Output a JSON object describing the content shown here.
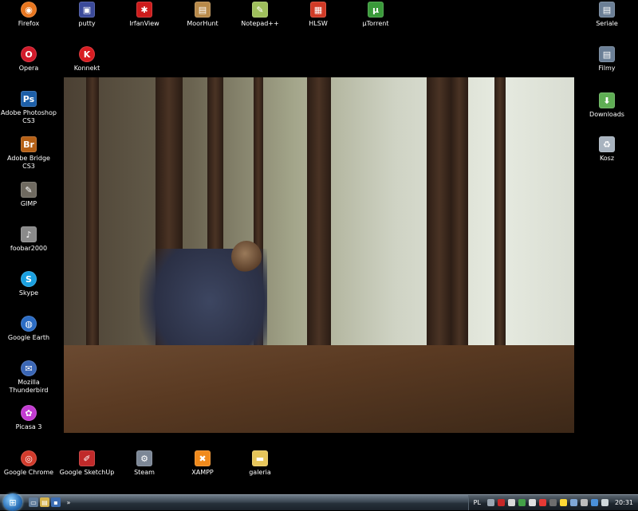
{
  "desktop": {
    "left_icons": [
      {
        "label": "Firefox",
        "name": "firefox",
        "glyph": "◉",
        "color": "#e8761f",
        "round": true
      },
      {
        "label": "Opera",
        "name": "opera",
        "glyph": "O",
        "color": "#d11a2a",
        "round": true
      },
      {
        "label": "Adobe Photoshop CS3",
        "name": "adobe-photoshop-cs3",
        "glyph": "Ps",
        "color": "#1d5fa8",
        "round": false
      },
      {
        "label": "Adobe Bridge CS3",
        "name": "adobe-bridge-cs3",
        "glyph": "Br",
        "color": "#b56016",
        "round": false
      },
      {
        "label": "GIMP",
        "name": "gimp",
        "glyph": "✎",
        "color": "#6f6a60",
        "round": false
      },
      {
        "label": "foobar2000",
        "name": "foobar2000",
        "glyph": "♪",
        "color": "#8a8a8a",
        "round": false
      },
      {
        "label": "Skype",
        "name": "skype",
        "glyph": "S",
        "color": "#1aa0e0",
        "round": true
      },
      {
        "label": "Google Earth",
        "name": "google-earth",
        "glyph": "◍",
        "color": "#2b6cc4",
        "round": true
      },
      {
        "label": "Mozilla Thunderbird",
        "name": "mozilla-thunderbird",
        "glyph": "✉",
        "color": "#3a66b5",
        "round": true
      },
      {
        "label": "Picasa 3",
        "name": "picasa-3",
        "glyph": "✿",
        "color": "#c23bd1",
        "round": true
      },
      {
        "label": "Google Chrome",
        "name": "google-chrome",
        "glyph": "◎",
        "color": "#d23b2c",
        "round": true
      }
    ],
    "top_icons": [
      {
        "label": "putty",
        "name": "putty",
        "glyph": "▣",
        "color": "#3b4a9a",
        "round": false
      },
      {
        "label": "Konnekt",
        "name": "konnekt",
        "glyph": "K",
        "color": "#d81d22",
        "round": true
      },
      {
        "label": "IrfanView",
        "name": "irfanview",
        "glyph": "✱",
        "color": "#cc1c1c",
        "round": false
      },
      {
        "label": "MoorHunt",
        "name": "moorhunt",
        "glyph": "▤",
        "color": "#b88a4a",
        "round": false
      },
      {
        "label": "Notepad++",
        "name": "notepad-plus-plus",
        "glyph": "✎",
        "color": "#9fbf5c",
        "round": false
      },
      {
        "label": "HLSW",
        "name": "hlsw",
        "glyph": "▦",
        "color": "#d03a26",
        "round": false
      },
      {
        "label": "µTorrent",
        "name": "utorrent",
        "glyph": "µ",
        "color": "#3a9a3a",
        "round": false
      }
    ],
    "bottom_icons": [
      {
        "label": "Google SketchUp",
        "name": "google-sketchup",
        "glyph": "✐",
        "color": "#c02a2a",
        "round": false
      },
      {
        "label": "Steam",
        "name": "steam",
        "glyph": "⚙",
        "color": "#7c8796",
        "round": false
      },
      {
        "label": "XAMPP",
        "name": "xampp",
        "glyph": "✖",
        "color": "#f08a1c",
        "round": false
      },
      {
        "label": "galeria",
        "name": "galeria",
        "glyph": "▬",
        "color": "#e6c55a",
        "round": false
      }
    ],
    "right_icons": [
      {
        "label": "Seriale",
        "name": "seriale",
        "glyph": "▤",
        "color": "#6b7f96",
        "round": false
      },
      {
        "label": "Filmy",
        "name": "filmy",
        "glyph": "▤",
        "color": "#6b7f96",
        "round": false
      },
      {
        "label": "Downloads",
        "name": "downloads",
        "glyph": "⬇",
        "color": "#5fae54",
        "round": false
      },
      {
        "label": "Kosz",
        "name": "kosz",
        "glyph": "♻",
        "color": "#a8b3bf",
        "round": false
      }
    ]
  },
  "taskbar": {
    "language": "PL",
    "clock": "20:31",
    "tray_colors": [
      "#9aa6b2",
      "#c62828",
      "#d9d9d9",
      "#43a047",
      "#e0e0e0",
      "#e53935",
      "#6d6d6d",
      "#fdd835",
      "#7fa7d6",
      "#bdbdbd",
      "#4a90d9",
      "#cfd8dc"
    ]
  }
}
